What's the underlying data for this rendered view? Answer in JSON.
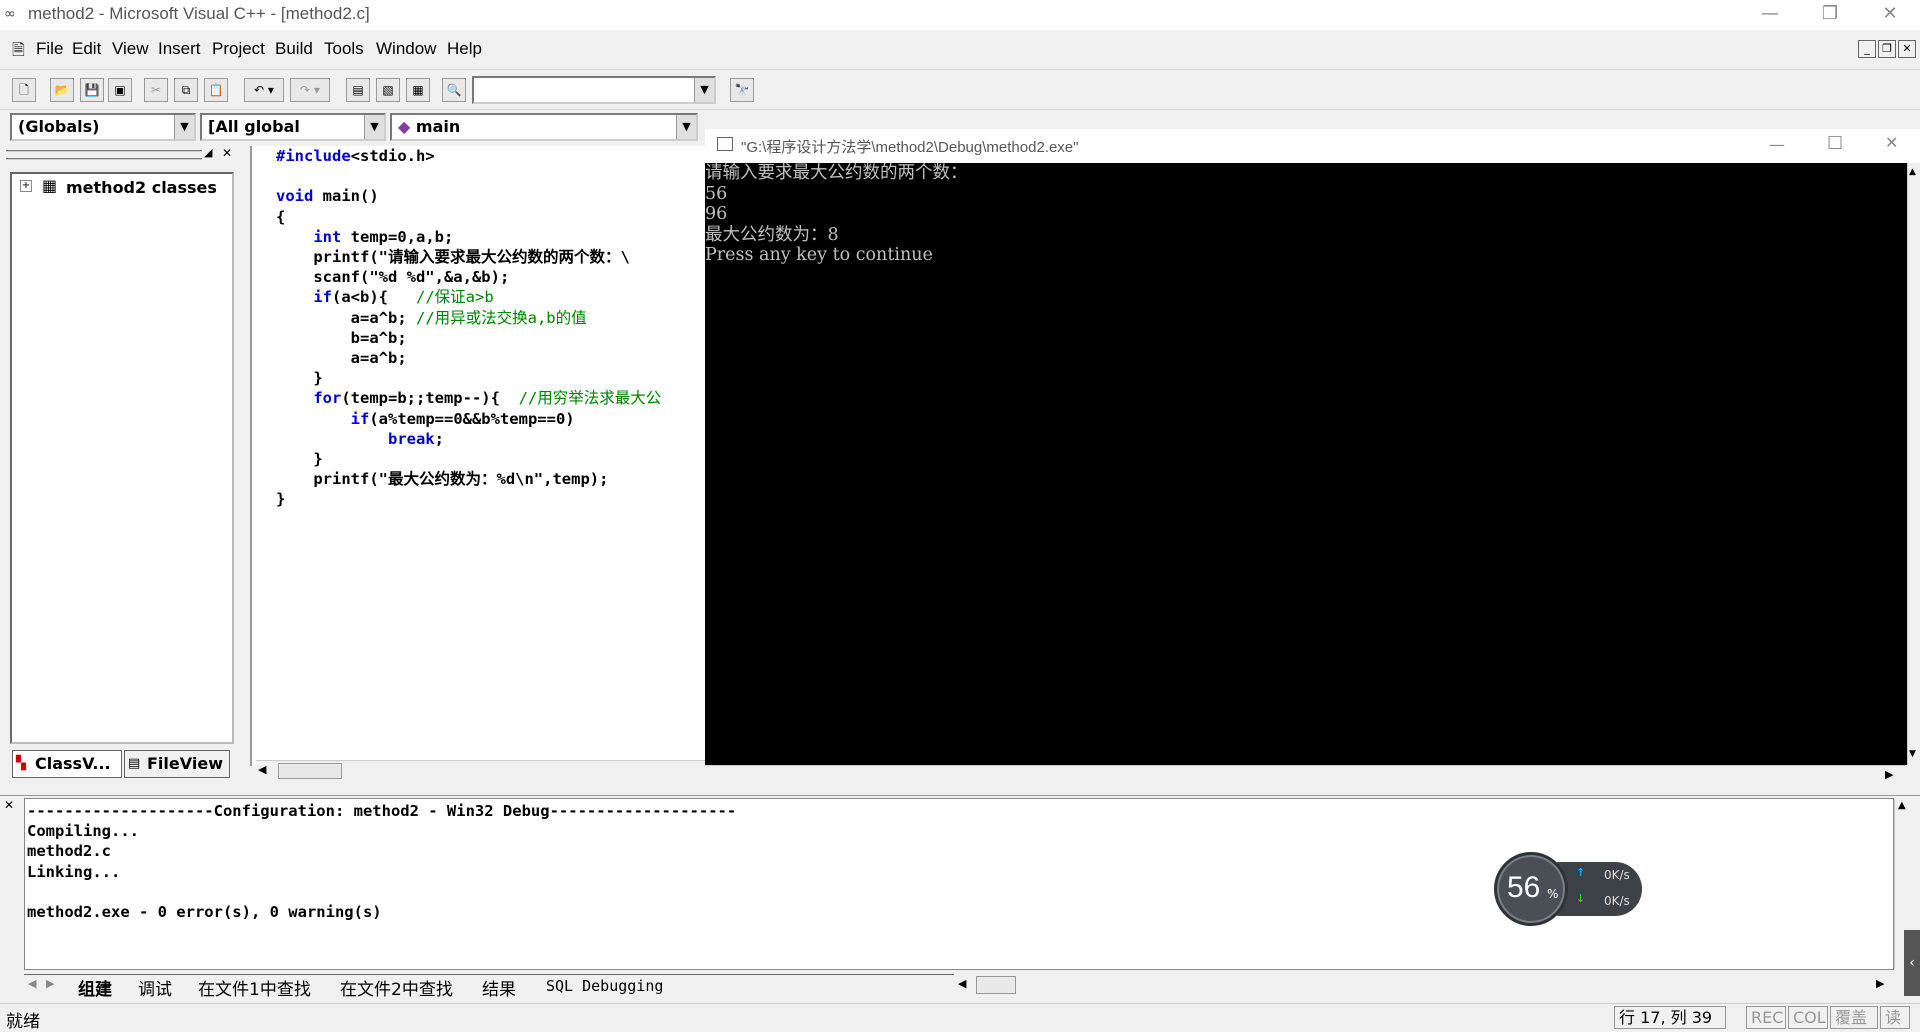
{
  "window": {
    "title": "method2 - Microsoft Visual C++ - [method2.c]",
    "minimize": "—",
    "restore": "❐",
    "close": "✕"
  },
  "menu": [
    "File",
    "Edit",
    "View",
    "Insert",
    "Project",
    "Build",
    "Tools",
    "Window",
    "Help"
  ],
  "wizard": {
    "globals": "(Globals)",
    "members": "[All global members",
    "func": "main"
  },
  "classview": {
    "tree_root": "method2 classes",
    "tab_class": "ClassV...",
    "tab_file": "FileView"
  },
  "editor": {
    "lines": [
      {
        "parts": [
          {
            "t": "#include",
            "c": "kw"
          },
          {
            "t": "<stdio.h>",
            "c": ""
          }
        ]
      },
      {
        "parts": [
          {
            "t": "",
            "c": ""
          }
        ]
      },
      {
        "parts": [
          {
            "t": "void",
            "c": "kw"
          },
          {
            "t": " main()",
            "c": ""
          }
        ]
      },
      {
        "parts": [
          {
            "t": "{",
            "c": ""
          }
        ]
      },
      {
        "parts": [
          {
            "t": "    ",
            "c": ""
          },
          {
            "t": "int",
            "c": "kw"
          },
          {
            "t": " temp=0,a,b;",
            "c": ""
          }
        ]
      },
      {
        "parts": [
          {
            "t": "    printf(\"请输入要求最大公约数的两个数：\\",
            "c": ""
          }
        ]
      },
      {
        "parts": [
          {
            "t": "    scanf(\"%d %d\",&a,&b);",
            "c": ""
          }
        ]
      },
      {
        "parts": [
          {
            "t": "    ",
            "c": ""
          },
          {
            "t": "if",
            "c": "kw"
          },
          {
            "t": "(a<b){   ",
            "c": ""
          },
          {
            "t": "//保证a>b",
            "c": "cm"
          }
        ]
      },
      {
        "parts": [
          {
            "t": "        a=a^b; ",
            "c": ""
          },
          {
            "t": "//用异或法交换a,b的值",
            "c": "cm"
          }
        ]
      },
      {
        "parts": [
          {
            "t": "        b=a^b;",
            "c": ""
          }
        ]
      },
      {
        "parts": [
          {
            "t": "        a=a^b;",
            "c": ""
          }
        ]
      },
      {
        "parts": [
          {
            "t": "    }",
            "c": ""
          }
        ]
      },
      {
        "parts": [
          {
            "t": "    ",
            "c": ""
          },
          {
            "t": "for",
            "c": "kw"
          },
          {
            "t": "(temp=b;;temp--){  ",
            "c": ""
          },
          {
            "t": "//用穷举法求最大公",
            "c": "cm"
          }
        ]
      },
      {
        "parts": [
          {
            "t": "        ",
            "c": ""
          },
          {
            "t": "if",
            "c": "kw"
          },
          {
            "t": "(a%temp==0&&b%temp==0)",
            "c": ""
          }
        ]
      },
      {
        "parts": [
          {
            "t": "            ",
            "c": ""
          },
          {
            "t": "break",
            "c": "kw"
          },
          {
            "t": ";",
            "c": ""
          }
        ]
      },
      {
        "parts": [
          {
            "t": "    }",
            "c": ""
          }
        ]
      },
      {
        "parts": [
          {
            "t": "    printf(\"最大公约数为：%d\\n\",temp);",
            "c": ""
          }
        ]
      },
      {
        "parts": [
          {
            "t": "}",
            "c": ""
          }
        ]
      }
    ]
  },
  "console": {
    "title": "\"G:\\程序设计方法学\\method2\\Debug\\method2.exe\"",
    "lines": [
      "请输入要求最大公约数的两个数：",
      "56",
      "96",
      "最大公约数为：8",
      "Press any key to continue"
    ]
  },
  "output": {
    "lines": [
      "--------------------Configuration: method2 - Win32 Debug--------------------",
      "Compiling...",
      "method2.c",
      "Linking...",
      "",
      "method2.exe - 0 error(s), 0 warning(s)"
    ],
    "tabs": [
      "组建",
      "调试",
      "在文件1中查找",
      "在文件2中查找",
      "结果",
      "SQL Debugging"
    ]
  },
  "status": {
    "left": "就绪",
    "position": "行 17, 列 39",
    "rec": "REC",
    "col": "COL",
    "ovr": "覆盖",
    "read": "读"
  },
  "widget": {
    "percent": "56",
    "unit": "%",
    "up": "0K/s",
    "down": "0K/s"
  }
}
